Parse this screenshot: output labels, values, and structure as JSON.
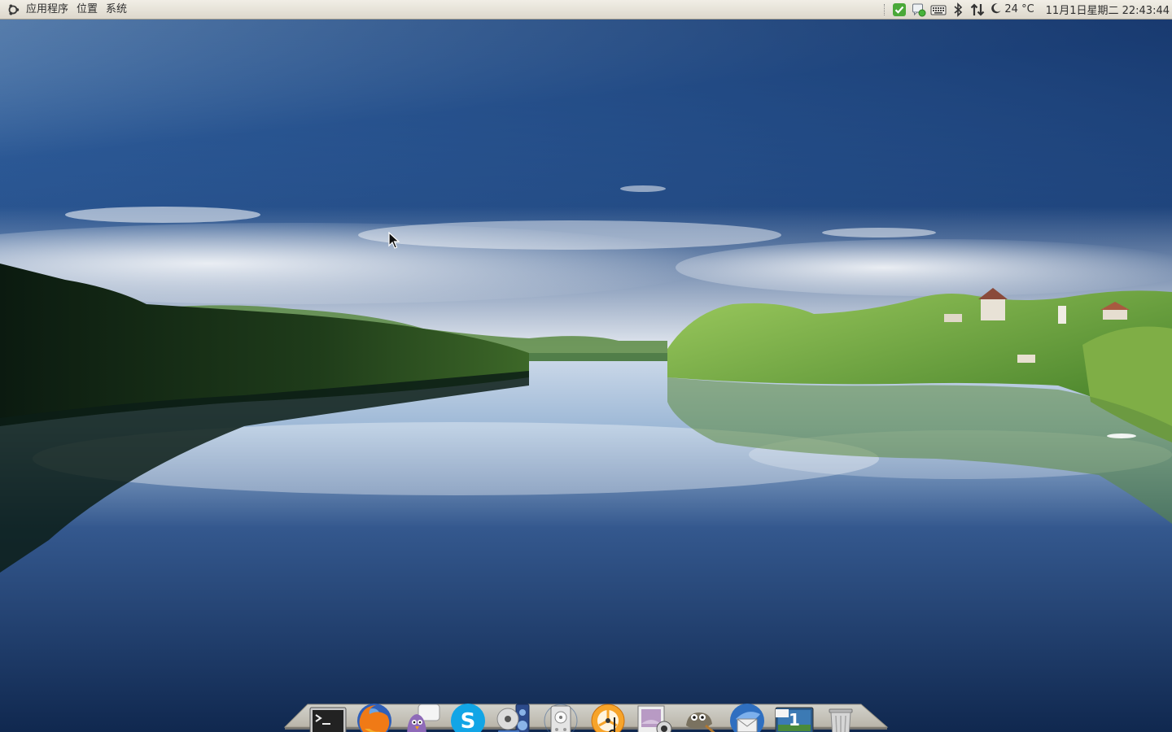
{
  "top_panel": {
    "menus": [
      "应用程序",
      "位置",
      "系统"
    ],
    "tray_icons": [
      "network-ok-icon",
      "chat-status-icon",
      "keyboard-icon",
      "bluetooth-icon",
      "network-transfer-icon"
    ],
    "weather": {
      "icon": "moon-icon",
      "temperature": "24 °C"
    },
    "clock": "11月1日星期二 22:43:44"
  },
  "dock": {
    "items": [
      {
        "name": "terminal",
        "icon": "terminal-icon",
        "running": false
      },
      {
        "name": "firefox",
        "icon": "firefox-icon",
        "running": true
      },
      {
        "name": "pidgin",
        "icon": "pidgin-icon",
        "running": false
      },
      {
        "name": "skype",
        "icon": "skype-icon",
        "running": false
      },
      {
        "name": "media-player",
        "icon": "media-player-icon",
        "running": false
      },
      {
        "name": "disk-utility",
        "icon": "disk-icon",
        "running": false
      },
      {
        "name": "music-player",
        "icon": "music-player-icon",
        "running": false
      },
      {
        "name": "screenshot",
        "icon": "screenshot-icon",
        "running": false
      },
      {
        "name": "gimp",
        "icon": "gimp-icon",
        "running": false
      },
      {
        "name": "thunderbird",
        "icon": "thunderbird-icon",
        "running": false
      },
      {
        "name": "workspace-switcher",
        "icon": "workspace-icon",
        "running": false,
        "label": "1"
      },
      {
        "name": "trash",
        "icon": "trash-icon",
        "running": false
      }
    ]
  },
  "colors": {
    "panel": "#e6e2d8",
    "running_indicator": "#e07818",
    "sky_top": "#1c3d72",
    "lake": "#1a3a6a",
    "hills": "#6aa838"
  }
}
